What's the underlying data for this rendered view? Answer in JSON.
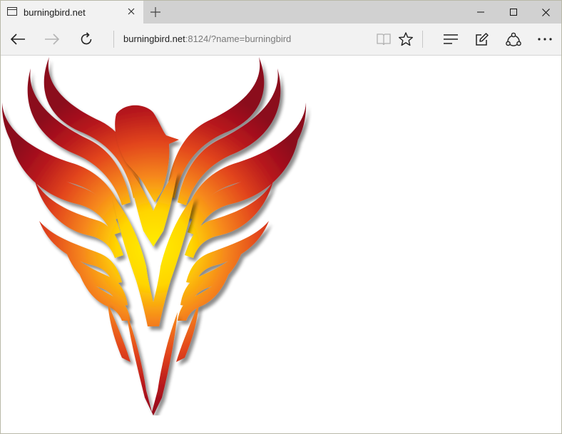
{
  "tab": {
    "title": "burningbird.net",
    "icon": "page-icon"
  },
  "address": {
    "host": "burningbird.net",
    "rest": ":8124/?name=burningbird"
  },
  "toolbar": {
    "back": "back-arrow-icon",
    "forward": "forward-arrow-icon",
    "refresh": "refresh-icon",
    "reading_view": "reading-view-icon",
    "favorite": "star-icon",
    "hub": "hub-icon",
    "web_note": "web-note-icon",
    "share": "share-icon",
    "more": "more-icon"
  },
  "content": {
    "image": "phoenix-image"
  },
  "colors": {
    "tab_active": "#f2f2f2",
    "tab_strip": "#d1d1d1",
    "flame_dark": "#9c0d1e",
    "flame_mid": "#f25a14",
    "flame_light": "#ffee00"
  }
}
